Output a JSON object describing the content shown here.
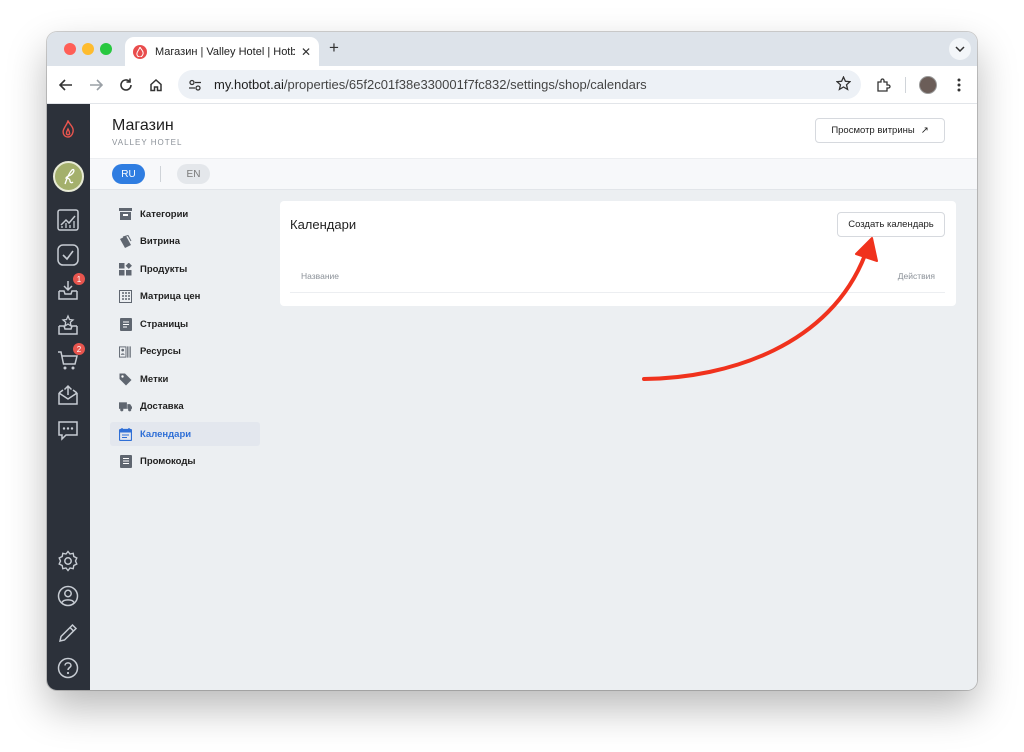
{
  "browser": {
    "tab_title": "Магазин | Valley Hotel | Hotbot",
    "url_host": "my.hotbot.ai",
    "url_path": "/properties/65f2c01f38e330001f7fc832/settings/shop/calendars",
    "new_tab_label": "+",
    "tab_close_label": "✕"
  },
  "rail": {
    "badges": {
      "inbox": "1",
      "cart": "2"
    }
  },
  "header": {
    "title": "Магазин",
    "subtitle": "VALLEY HOTEL",
    "preview_label": "Просмотр витрины",
    "preview_icon": "↗"
  },
  "languages": {
    "ru": "RU",
    "en": "EN"
  },
  "sidebar": {
    "items": [
      {
        "label": "Категории",
        "icon": "category-icon"
      },
      {
        "label": "Витрина",
        "icon": "showcase-icon"
      },
      {
        "label": "Продукты",
        "icon": "products-icon"
      },
      {
        "label": "Матрица цен",
        "icon": "price-matrix-icon"
      },
      {
        "label": "Страницы",
        "icon": "pages-icon"
      },
      {
        "label": "Ресурсы",
        "icon": "resources-icon"
      },
      {
        "label": "Метки",
        "icon": "tag-icon"
      },
      {
        "label": "Доставка",
        "icon": "truck-icon"
      },
      {
        "label": "Календари",
        "icon": "calendar-icon",
        "active": true
      },
      {
        "label": "Промокоды",
        "icon": "promo-icon"
      }
    ]
  },
  "main": {
    "title": "Календари",
    "create_label": "Создать календарь",
    "columns": [
      "Название",
      "Действия"
    ]
  },
  "colors": {
    "accent": "#2f7de1",
    "rail_bg": "#2c313a",
    "badge": "#e8554e",
    "annotation_arrow": "#f0321d"
  }
}
